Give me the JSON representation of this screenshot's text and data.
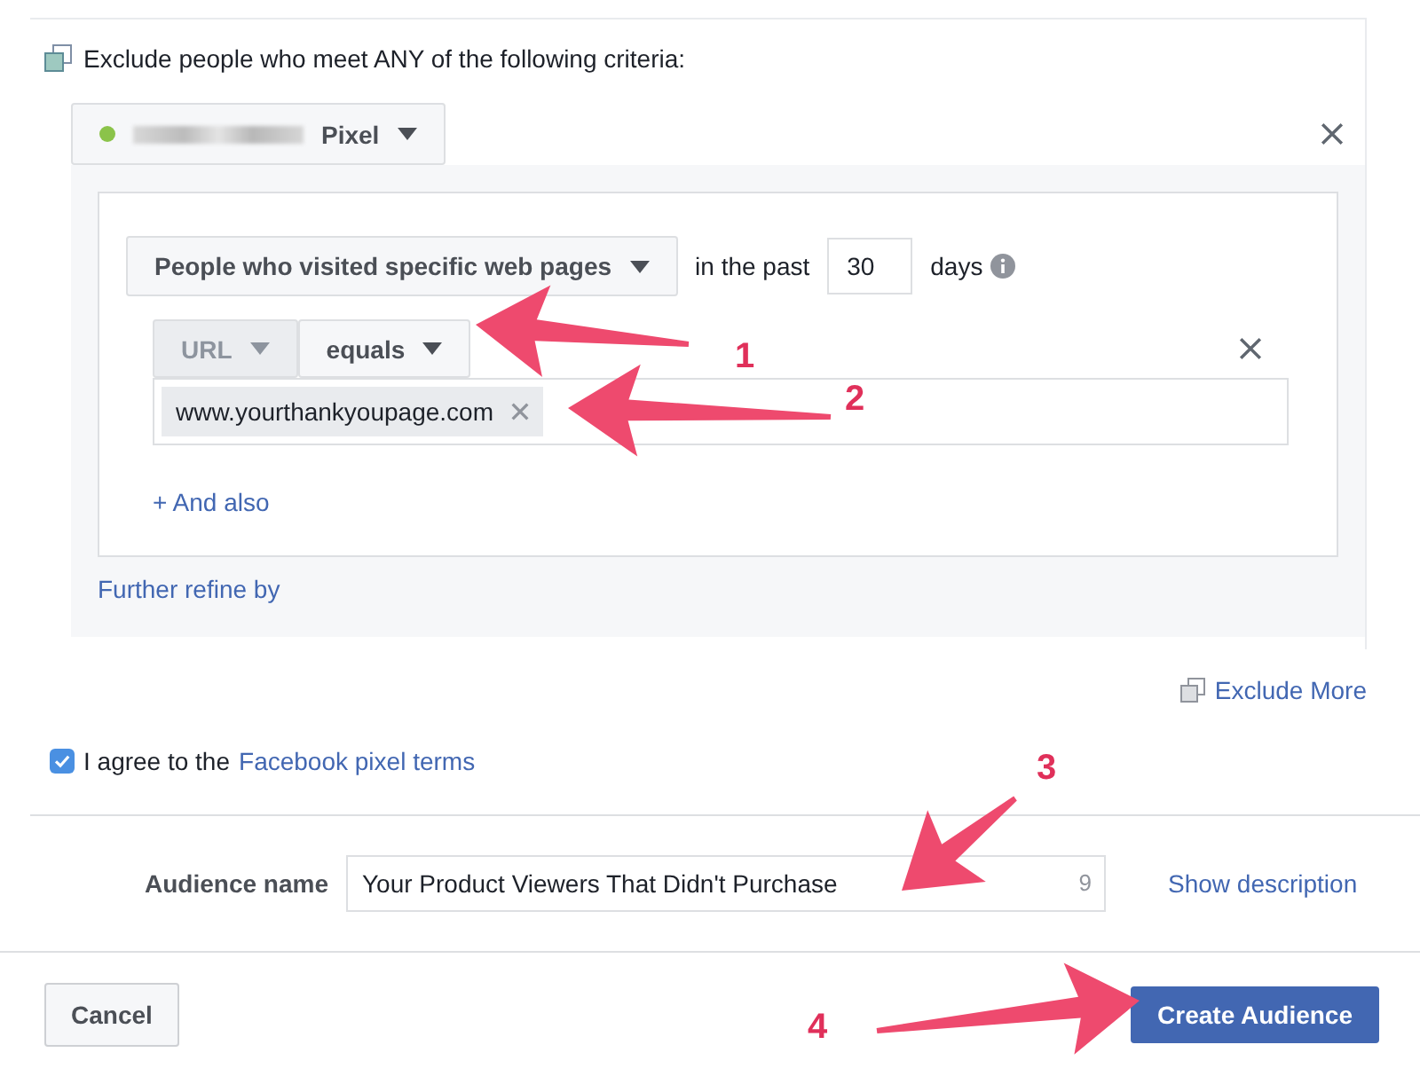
{
  "criteria": {
    "heading": "Exclude people who meet ANY of the following criteria:"
  },
  "pixel": {
    "name": "Pixel",
    "active": true
  },
  "rule": {
    "event": "People who visited specific web pages",
    "window_prefix": "in the past",
    "days": "30",
    "window_suffix": "days",
    "field": {
      "label": "URL",
      "disabled": true
    },
    "operator": "equals",
    "values": [
      "www.yourthankyoupage.com"
    ],
    "add_link": "+ And also"
  },
  "refine_link": "Further refine by",
  "exclude_more": "Exclude More",
  "terms": {
    "checked": true,
    "text": "I agree to the",
    "link": "Facebook pixel terms"
  },
  "audience_name": {
    "label": "Audience name",
    "value": "Your Product Viewers That Didn't Purchase",
    "counter": "9",
    "link": "Show description"
  },
  "buttons": {
    "cancel": "Cancel",
    "create": "Create Audience"
  },
  "annotations": [
    {
      "label": "1"
    },
    {
      "label": "2"
    },
    {
      "label": "3"
    },
    {
      "label": "4"
    }
  ]
}
